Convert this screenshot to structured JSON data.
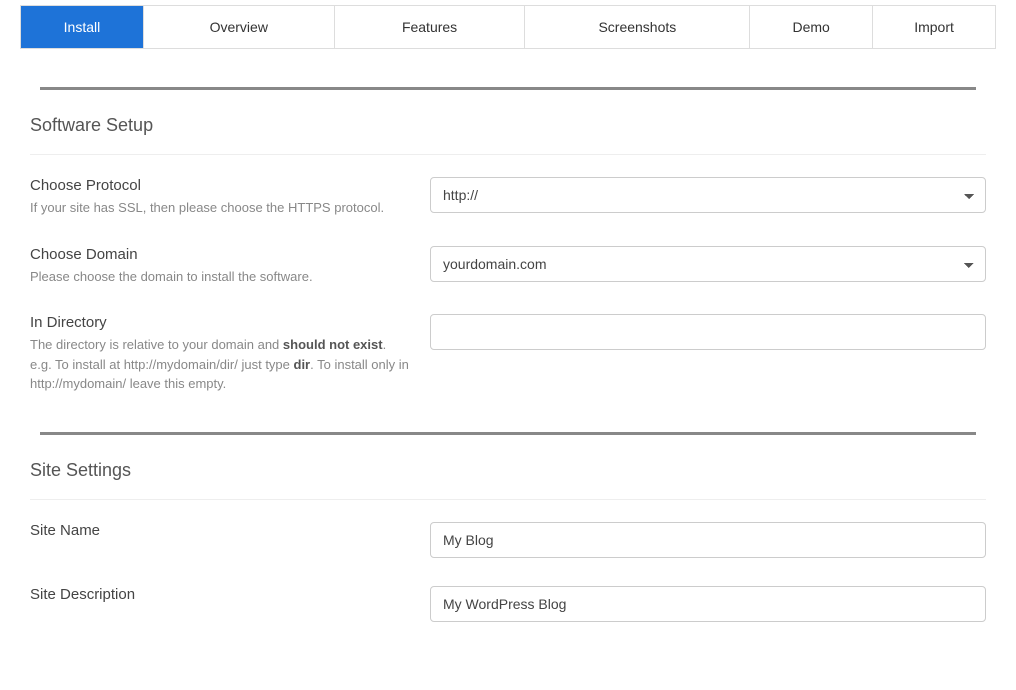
{
  "tabs": {
    "install": "Install",
    "overview": "Overview",
    "features": "Features",
    "screenshots": "Screenshots",
    "demo": "Demo",
    "import": "Import"
  },
  "sections": {
    "software_setup": {
      "title": "Software Setup",
      "protocol": {
        "label": "Choose Protocol",
        "help": "If your site has SSL, then please choose the HTTPS protocol.",
        "value": "http://"
      },
      "domain": {
        "label": "Choose Domain",
        "help": "Please choose the domain to install the software.",
        "value": "yourdomain.com"
      },
      "directory": {
        "label": "In Directory",
        "help_pre": "The directory is relative to your domain and ",
        "help_bold1": "should not exist",
        "help_mid": ". e.g. To install at http://mydomain/dir/ just type ",
        "help_bold2": "dir",
        "help_post": ". To install only in http://mydomain/ leave this empty.",
        "value": ""
      }
    },
    "site_settings": {
      "title": "Site Settings",
      "site_name": {
        "label": "Site Name",
        "value": "My Blog"
      },
      "site_description": {
        "label": "Site Description",
        "value": "My WordPress Blog"
      }
    }
  }
}
